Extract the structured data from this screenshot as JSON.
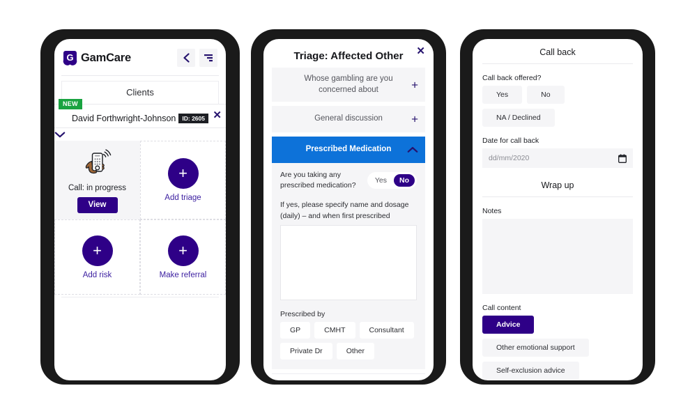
{
  "phone1": {
    "header": {
      "brand": "GamCare",
      "back_icon": "chevron-left-icon",
      "menu_icon": "filter-list-icon"
    },
    "tab": {
      "label": "Clients"
    },
    "client": {
      "badge": "NEW",
      "name": "David Forthwright-Johnson",
      "id_chip": "ID: 2605",
      "close_icon": "close-icon",
      "expand_icon": "chevron-down-icon"
    },
    "tiles": [
      {
        "label": "Call: in progress",
        "icon": "hand-holding-phone-icon",
        "button": "View",
        "state": "active"
      },
      {
        "label": "Add triage",
        "icon": "plus-circle-icon"
      },
      {
        "label": "Add risk",
        "icon": "plus-circle-icon"
      },
      {
        "label": "Make referral",
        "icon": "plus-circle-icon"
      }
    ]
  },
  "phone2": {
    "title": "Triage: Affected Other",
    "close_icon": "close-icon",
    "sections": [
      {
        "label": "Whose gambling are you concerned about",
        "state": "collapsed",
        "icon": "plus-icon"
      },
      {
        "label": "General discussion",
        "state": "collapsed",
        "icon": "plus-icon"
      },
      {
        "label": "Prescribed Medication",
        "state": "expanded",
        "icon": "chevron-up-icon"
      }
    ],
    "medication": {
      "question": "Are you taking any prescribed medication?",
      "toggle_options": [
        "Yes",
        "No"
      ],
      "toggle_selected": "No",
      "textarea_label": "If yes, please specify name and dosage (daily) – and when first prescribed",
      "textarea_value": "",
      "prescribed_by_label": "Prescribed by",
      "prescribed_by_options": [
        "GP",
        "CMHT",
        "Consultant",
        "Private Dr",
        "Other"
      ],
      "prescribed_by_selected": ""
    }
  },
  "phone3": {
    "callback": {
      "title": "Call back",
      "offered_label": "Call back offered?",
      "offered_options": [
        "Yes",
        "No",
        "NA / Declined"
      ],
      "offered_selected": "",
      "date_label": "Date for call back",
      "date_placeholder": "dd/mm/2020",
      "date_value": "",
      "calendar_icon": "calendar-icon"
    },
    "wrapup": {
      "title": "Wrap up",
      "notes_label": "Notes",
      "notes_value": "",
      "call_content_label": "Call content",
      "call_content_options": [
        "Advice",
        "Other emotional support",
        "Self-exclusion advice"
      ],
      "call_content_selected": "Advice"
    }
  },
  "colors": {
    "purple": "#2e0087",
    "blue": "#0d72d9",
    "green": "#19a340",
    "panel": "#f5f5f7",
    "dark": "#1d1f24"
  }
}
